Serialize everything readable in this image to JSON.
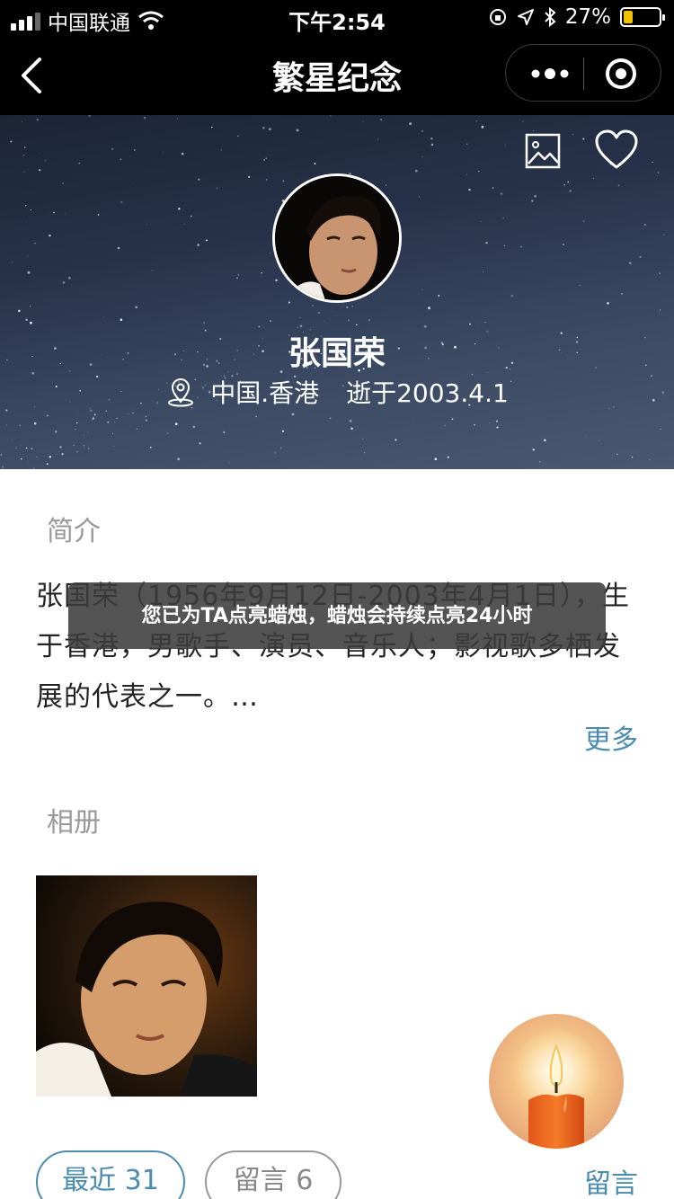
{
  "status_bar": {
    "carrier": "中国联通",
    "time": "下午2:54",
    "battery_percent_label": "27%",
    "battery_level": 0.27,
    "battery_color": "#f2c200"
  },
  "nav": {
    "title": "繁星纪念",
    "back_icon": "chevron-left-icon",
    "more_icon": "more-dots-icon",
    "close_icon": "target-close-icon"
  },
  "hero": {
    "name": "张国荣",
    "location": "中国.香港",
    "death": "逝于2003.4.1",
    "image_icon": "image-icon",
    "heart_icon": "heart-icon",
    "location_icon": "location-pin-icon"
  },
  "intro": {
    "title": "简介",
    "text": "张国荣（1956年9月12日-2003年4月1日），生于香港，男歌手、演员、音乐人；影视歌多栖发展的代表之一。…",
    "more": "更多"
  },
  "album": {
    "title": "相册"
  },
  "candle": {
    "icon": "candle-icon"
  },
  "tabs": {
    "recent": "最近 31",
    "comments": "留言 6"
  },
  "leave_comment": "留言",
  "toast": {
    "text": "您已为TA点亮蜡烛，蜡烛会持续点亮24小时"
  },
  "colors": {
    "accent": "#4a8cb0",
    "header_bg": "#000000"
  }
}
